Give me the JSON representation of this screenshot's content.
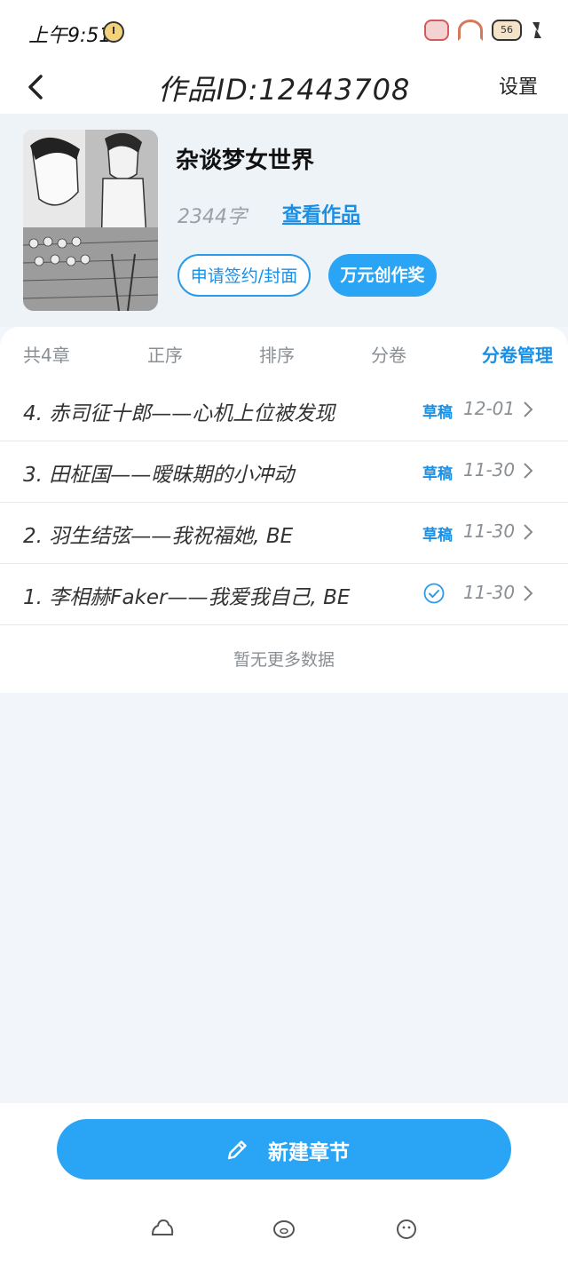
{
  "status": {
    "time": "上午9:51",
    "battery": "56"
  },
  "header": {
    "title": "作品ID:12443708",
    "settings_label": "设置"
  },
  "work": {
    "title": "杂谈梦女世界",
    "word_count": "2344字",
    "view_link": "查看作品",
    "apply_button": "申请签约/封面",
    "award_button": "万元创作奖"
  },
  "toolbar": {
    "count": "共4章",
    "order": "正序",
    "sort": "排序",
    "volume": "分卷",
    "manage": "分卷管理"
  },
  "chapters": [
    {
      "title": "4. 赤司征十郎——心机上位被发现",
      "status": "草稿",
      "date": "12-01"
    },
    {
      "title": "3. 田柾国——暧昧期的小冲动",
      "status": "草稿",
      "date": "11-30"
    },
    {
      "title": "2. 羽生结弦——我祝福她, BE",
      "status": "草稿",
      "date": "11-30"
    },
    {
      "title": "1. 李相赫Faker——我爱我自己, BE",
      "status": "published",
      "date": "11-30"
    }
  ],
  "no_more": "暂无更多数据",
  "new_chapter_label": "新建章节",
  "colors": {
    "accent": "#2aa5f5",
    "link": "#1a8fe6",
    "background": "#f2f6fa"
  }
}
